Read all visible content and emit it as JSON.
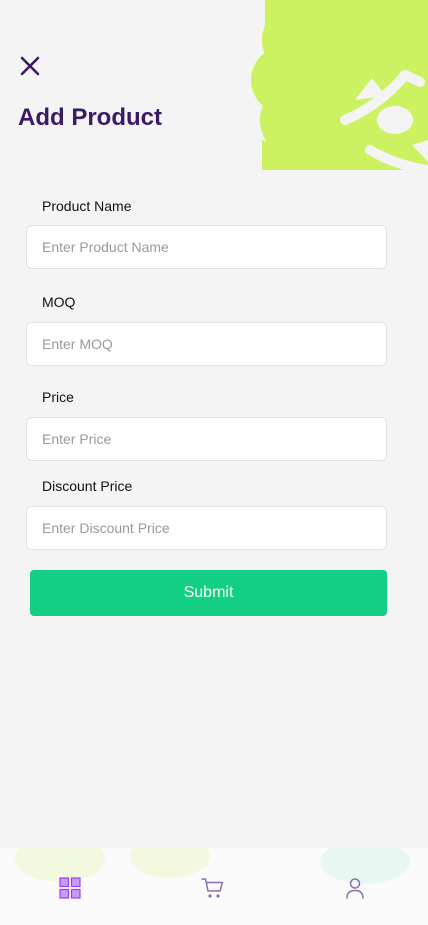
{
  "header": {
    "title": "Add Product"
  },
  "form": {
    "fields": [
      {
        "label": "Product Name",
        "placeholder": "Enter Product Name",
        "value": ""
      },
      {
        "label": "MOQ",
        "placeholder": "Enter MOQ",
        "value": ""
      },
      {
        "label": "Price",
        "placeholder": "Enter Price",
        "value": ""
      },
      {
        "label": "Discount Price",
        "placeholder": "Enter Discount Price",
        "value": ""
      }
    ],
    "submit_label": "Submit"
  },
  "bottom_nav": {
    "items": [
      {
        "icon": "grid-icon",
        "active": true
      },
      {
        "icon": "cart-icon",
        "active": false
      },
      {
        "icon": "user-icon",
        "active": false
      }
    ]
  },
  "colors": {
    "title": "#3b1a66",
    "accent_green": "#12cf84",
    "decor_lime": "#ccf262",
    "nav_active": "#9b3df5",
    "nav_inactive": "#8b6fb0"
  }
}
